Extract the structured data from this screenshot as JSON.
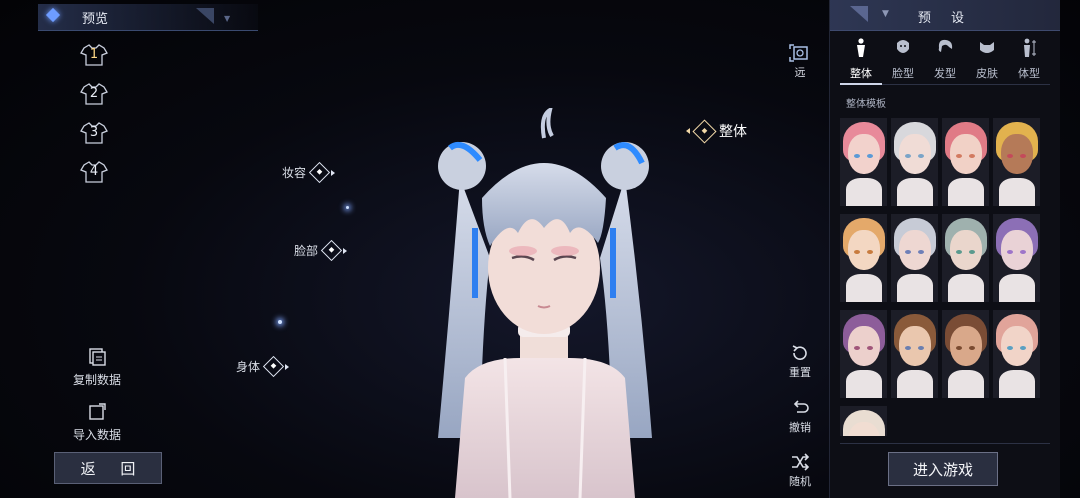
{
  "preview": {
    "label": "预览"
  },
  "slots": [
    {
      "label": "1",
      "active": true
    },
    {
      "label": "2"
    },
    {
      "label": "3"
    },
    {
      "label": "4"
    }
  ],
  "left_actions": {
    "copy_label": "复制数据",
    "import_label": "导入数据",
    "back_label": "返 回"
  },
  "focus_points": {
    "makeup": "妆容",
    "face": "脸部",
    "body": "身体",
    "whole": "整体"
  },
  "controls": {
    "far_label": "远",
    "reset_label": "重置",
    "undo_label": "撤销",
    "random_label": "随机"
  },
  "panel": {
    "title": "预 设",
    "tabs": [
      {
        "label": "整体",
        "icon": "figure-icon",
        "active": true
      },
      {
        "label": "脸型",
        "icon": "face-shape-icon"
      },
      {
        "label": "发型",
        "icon": "hairstyle-icon"
      },
      {
        "label": "皮肤",
        "icon": "skin-icon"
      },
      {
        "label": "体型",
        "icon": "body-type-icon"
      }
    ],
    "section_label": "整体模板",
    "templates": [
      {
        "hair": "#e88a9a",
        "skin": "#f2d2cc",
        "eye": "#5a9ad6"
      },
      {
        "hair": "#d8d8dc",
        "skin": "#f0dcd6",
        "eye": "#7aa4c8"
      },
      {
        "hair": "#e07b86",
        "skin": "#f1d1c6",
        "eye": "#d27a60"
      },
      {
        "hair": "#e2b24e",
        "skin": "#b57a58",
        "eye": "#c44a5a"
      },
      {
        "hair": "#e4a96a",
        "skin": "#f3d7c2",
        "eye": "#c87b3e"
      },
      {
        "hair": "#c7cbd6",
        "skin": "#eed7d2",
        "eye": "#6e7fb8"
      },
      {
        "hair": "#9fb1ae",
        "skin": "#ead6cc",
        "eye": "#5a9a8e"
      },
      {
        "hair": "#8c6fb6",
        "skin": "#e9d2d6",
        "eye": "#9d74c9"
      },
      {
        "hair": "#8d5d9a",
        "skin": "#ecd0cc",
        "eye": "#a0557a"
      },
      {
        "hair": "#8a5a3a",
        "skin": "#eac7ae",
        "eye": "#6a7fb0"
      },
      {
        "hair": "#7a4c35",
        "skin": "#d9a88a",
        "eye": "#7a4a30"
      },
      {
        "hair": "#e1a49a",
        "skin": "#f1d4c8",
        "eye": "#5aa0c2"
      },
      {
        "hair": "#e9ddd2",
        "skin": "#f1ddd2",
        "eye": "#8a8a8a"
      }
    ],
    "enter_label": "进入游戏"
  },
  "colors": {
    "accent": "#6e9cff",
    "gold": "#ffd987"
  }
}
